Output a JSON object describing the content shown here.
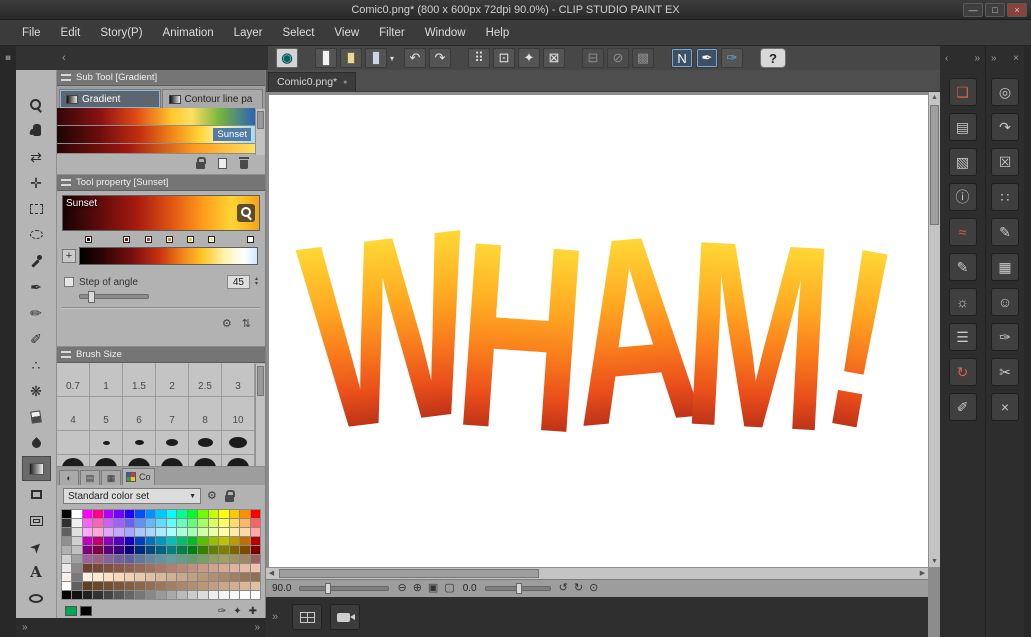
{
  "titlebar": {
    "title": "Comic0.png* (800 x 600px 72dpi 90.0%)  - CLIP STUDIO PAINT EX",
    "controls": [
      {
        "n": "minimize-button",
        "g": "—"
      },
      {
        "n": "restore-button",
        "g": "□"
      },
      {
        "n": "close-button",
        "g": "×"
      }
    ]
  },
  "menubar": {
    "items": [
      "File",
      "Edit",
      "Story(P)",
      "Animation",
      "Layer",
      "Select",
      "View",
      "Filter",
      "Window",
      "Help"
    ]
  },
  "command_bar": {
    "buttons": [
      {
        "n": "csp-logo-button",
        "g": "◉",
        "cls": "cbtn logo"
      },
      {
        "n": "new-file-button",
        "g": "",
        "cls": "cbtn i-page16 sp"
      },
      {
        "n": "open-file-button",
        "g": "",
        "cls": "cbtn i-folder16"
      },
      {
        "n": "save-button",
        "g": "",
        "cls": "cbtn i-floppy16 drop"
      },
      {
        "n": "undo-button",
        "g": "↶",
        "cls": "cbtn sp"
      },
      {
        "n": "redo-button",
        "g": "↷",
        "cls": "cbtn"
      },
      {
        "n": "delete-button",
        "g": "⠿",
        "cls": "cbtn sp"
      },
      {
        "n": "deselect-button",
        "g": "⊡",
        "cls": "cbtn"
      },
      {
        "n": "fill-button",
        "g": "✦",
        "cls": "cbtn"
      },
      {
        "n": "transform-button",
        "g": "⊠",
        "cls": "cbtn"
      },
      {
        "n": "align-left-button",
        "g": "⊟",
        "cls": "cbtn dis sp"
      },
      {
        "n": "align-center-button",
        "g": "⊘",
        "cls": "cbtn dis"
      },
      {
        "n": "align-grid-button",
        "g": "▩",
        "cls": "cbtn dis"
      },
      {
        "n": "no-correction-button",
        "g": "N",
        "cls": "cbtn on sp"
      },
      {
        "n": "stabilize-button",
        "g": "✒",
        "cls": "cbtn on"
      },
      {
        "n": "vector-snap-button",
        "g": "✑",
        "cls": "cbtn blue"
      },
      {
        "n": "help-button",
        "g": "?",
        "cls": "cbtn help sp"
      }
    ]
  },
  "left_dock": {
    "tools": [
      {
        "n": "zoom-tool",
        "g": "",
        "cls": "ticon i-zoom",
        "wcls": "tool-btn"
      },
      {
        "n": "hand-tool",
        "g": "",
        "cls": "ticon i-hand",
        "wcls": "tool-btn"
      },
      {
        "n": "flip-canvas-tool",
        "g": "⇄",
        "cls": "ticon",
        "wcls": "tool-btn"
      },
      {
        "n": "move-tool",
        "g": "✛",
        "cls": "ticon",
        "wcls": "tool-btn"
      },
      {
        "n": "marquee-select-tool",
        "g": "",
        "cls": "ticon i-rect",
        "wcls": "tool-btn"
      },
      {
        "n": "lasso-select-tool",
        "g": "",
        "cls": "ticon i-lasso",
        "wcls": "tool-btn"
      },
      {
        "n": "eyedropper-tool",
        "g": "",
        "cls": "ticon i-eyedrop",
        "wcls": "tool-btn"
      },
      {
        "n": "pen-tool",
        "g": "✒",
        "cls": "ticon",
        "wcls": "tool-btn"
      },
      {
        "n": "pencil-tool",
        "g": "✏",
        "cls": "ticon",
        "wcls": "tool-btn"
      },
      {
        "n": "brush-tool",
        "g": "✐",
        "cls": "ticon",
        "wcls": "tool-btn"
      },
      {
        "n": "airbrush-tool",
        "g": "∴",
        "cls": "ticon",
        "wcls": "tool-btn"
      },
      {
        "n": "decoration-tool",
        "g": "❋",
        "cls": "ticon",
        "wcls": "tool-btn"
      },
      {
        "n": "eraser-tool",
        "g": "",
        "cls": "ticon i-eraser",
        "wcls": "tool-btn"
      },
      {
        "n": "blend-tool",
        "g": "",
        "cls": "ticon i-drop",
        "wcls": "tool-btn"
      },
      {
        "n": "gradient-tool",
        "g": "",
        "cls": "ticon i-grad",
        "wcls": "tool-btn active"
      },
      {
        "n": "figure-tool",
        "g": "",
        "cls": "ticon i-square",
        "wcls": "tool-btn"
      },
      {
        "n": "frame-border-tool",
        "g": "",
        "cls": "ticon i-frame",
        "wcls": "tool-btn"
      },
      {
        "n": "operation-tool",
        "g": "➤",
        "cls": "ticon rotm45",
        "wcls": "tool-btn"
      },
      {
        "n": "text-tool",
        "g": "A",
        "cls": "ticon bold",
        "wcls": "tool-btn"
      },
      {
        "n": "balloon-tool",
        "g": "",
        "cls": "ticon i-balloon",
        "wcls": "tool-btn"
      }
    ]
  },
  "panels": {
    "sub_tool": {
      "header": "Sub Tool [Gradient]",
      "tabs": [
        {
          "label": "Gradient",
          "cls": "st-tab active",
          "n": "tab-gradient"
        },
        {
          "label": "Contour line pa",
          "cls": "st-tab",
          "n": "tab-contour-line"
        }
      ],
      "presets": [
        {
          "name": "",
          "style": "background:linear-gradient(90deg,#30060a 0%,#8c1212 22%,#e04a14 40%,#ffc62e 58%,#ffe061 68%,#77b43c 82%,#2b62b8 100%)",
          "lcls": "plabel",
          "n": "preset-row"
        },
        {
          "name": "Sunset",
          "style": "background:linear-gradient(90deg,#1c0404 0%,#6e0d0d 22%,#c42f10 42%,#f08519 58%,#ffd435 72%,#fff3a0 82%,#a8daf2 100%)",
          "lcls": "plabel sel",
          "n": "preset-row-sunset"
        },
        {
          "name": "",
          "style": "background:linear-gradient(90deg,#2a0505 0%,#a01410 35%,#ff9c1d 70%,#ffe061 100%)",
          "lcls": "plabel",
          "n": "preset-row"
        }
      ]
    },
    "tool_property": {
      "header": "Tool property [Sunset]",
      "preset_name": "Sunset",
      "preview_gradient": "linear-gradient(90deg,#170202 0%,#5c0b0b 18%,#a81b0e 38%,#e05313 55%,#ff9e1c 72%,#ffd435 86%,#f2a51a 100%)",
      "ramp_gradient": "linear-gradient(90deg,#000000 0%,#2a0404 12%,#7a0e0e 30%,#c8330f 45%,#f08519 58%,#ffc92b 70%,#fff3b0 82%,#ffffff 93%,#cfe9ff 100%)",
      "stops": [
        {
          "style": "left:2%;background:#3a0606"
        },
        {
          "style": "left:24%;background:#8a1010"
        },
        {
          "style": "left:36%;background:#d43a10"
        },
        {
          "style": "left:48%;background:#f07f1a"
        },
        {
          "style": "left:60%;background:#ffc31e"
        },
        {
          "style": "left:72%;background:#ffe95e"
        },
        {
          "style": "left:94%;background:#ffffff"
        }
      ],
      "angle": {
        "label": "Step of angle",
        "value": "45"
      },
      "plus_label": "+"
    },
    "brush_size": {
      "header": "Brush Size",
      "sizes": [
        "0.7",
        "1",
        "1.5",
        "2",
        "2.5",
        "3",
        "4",
        "5",
        "6",
        "7",
        "8",
        "10"
      ]
    },
    "color_set": {
      "tab_label": "Co",
      "dropdown_label": "Standard color set",
      "icon_tabs": [
        {
          "n": "color-wheel-tab",
          "g": "◐"
        },
        {
          "n": "color-slider-tab",
          "g": "▤"
        },
        {
          "n": "intermediate-color-tab",
          "g": "▦"
        }
      ],
      "footer_icons": [
        {
          "n": "eyedropper-icon",
          "g": "✑"
        },
        {
          "n": "key-icon",
          "g": "✦"
        },
        {
          "n": "add-swatch-icon",
          "g": "✚"
        }
      ],
      "recent": [
        "#00a651",
        "#000000"
      ],
      "colors": [
        "#000000",
        "#ffffff",
        "#ff00ff",
        "#ff0090",
        "#b000ff",
        "#7000ff",
        "#2000ff",
        "#0050ff",
        "#0090ff",
        "#00c8ff",
        "#00ffff",
        "#00ff90",
        "#00ff28",
        "#70ff00",
        "#c8ff00",
        "#ffff00",
        "#ffc800",
        "#ff9000",
        "#ff0000",
        "#303030",
        "#f0f0f0",
        "#ff60ff",
        "#ff60b8",
        "#cc60ff",
        "#a060ff",
        "#6a60ff",
        "#6090ff",
        "#60b8ff",
        "#60dcff",
        "#60ffff",
        "#60ffc0",
        "#60ff78",
        "#a8ff60",
        "#dcff60",
        "#ffff60",
        "#ffdc60",
        "#ffb860",
        "#ff6060",
        "#606060",
        "#e0e0e0",
        "#ffa8ff",
        "#ffa8d8",
        "#e0a8ff",
        "#c8a8ff",
        "#a8a8ff",
        "#a8c8ff",
        "#a8d8ff",
        "#a8ecff",
        "#a8ffff",
        "#a8ffdc",
        "#a8ffb8",
        "#d0ffa8",
        "#ecffa8",
        "#ffffa8",
        "#ffeca8",
        "#ffd8a8",
        "#ffa8a8",
        "#909090",
        "#d0d0d0",
        "#c000c0",
        "#c00070",
        "#8800c0",
        "#5500c0",
        "#1800c0",
        "#0040c0",
        "#0070c0",
        "#0098c0",
        "#00c0c0",
        "#00c070",
        "#00c020",
        "#58c000",
        "#98c000",
        "#c0c000",
        "#c09800",
        "#c07000",
        "#c00000",
        "#b0b0b0",
        "#c0c0c0",
        "#800080",
        "#80004a",
        "#5a0080",
        "#380080",
        "#100080",
        "#002a80",
        "#004a80",
        "#006480",
        "#008080",
        "#00804a",
        "#008015",
        "#3a8000",
        "#648000",
        "#808000",
        "#806400",
        "#804a00",
        "#800000",
        "#d0d0d0",
        "#a0a0a0",
        "#a060a0",
        "#a06080",
        "#8860a0",
        "#7060a0",
        "#6060a0",
        "#6078a0",
        "#6088a0",
        "#6094a0",
        "#60a0a0",
        "#60a088",
        "#60a068",
        "#78a060",
        "#94a060",
        "#a0a060",
        "#a09460",
        "#a08860",
        "#a06060",
        "#e8e8e8",
        "#888888",
        "#704030",
        "#784838",
        "#805040",
        "#885848",
        "#906050",
        "#986858",
        "#a07060",
        "#a87868",
        "#b08070",
        "#b88878",
        "#c09080",
        "#c89888",
        "#d0a090",
        "#d8a898",
        "#e0b0a0",
        "#e8b8a8",
        "#f0c0b0",
        "#f8f0e8",
        "#787878",
        "#fff0e0",
        "#ffe8d0",
        "#ffe0c0",
        "#f8d8b8",
        "#f0d0b0",
        "#e8c8a8",
        "#e0c0a0",
        "#d8b898",
        "#d0b090",
        "#c8a888",
        "#c0a080",
        "#b89878",
        "#b09070",
        "#a88868",
        "#a08060",
        "#987858",
        "#907050",
        "#ffffff",
        "#606060",
        "#604020",
        "#684828",
        "#705030",
        "#785838",
        "#806040",
        "#886848",
        "#907050",
        "#987858",
        "#a08060",
        "#a88868",
        "#b09070",
        "#b89878",
        "#c0a080",
        "#c8a888",
        "#d0b090",
        "#d8b898",
        "#e0c0a0",
        "#000000",
        "#111111",
        "#222222",
        "#333333",
        "#444444",
        "#555555",
        "#666666",
        "#777777",
        "#888888",
        "#999999",
        "#aaaaaa",
        "#bbbbbb",
        "#cccccc",
        "#dddddd",
        "#eeeeee",
        "#f4f4f4",
        "#f8f8f8",
        "#fcfcfc",
        "#ffffff"
      ]
    }
  },
  "canvas": {
    "tab": "Comic0.png*",
    "text": "WHAM!",
    "letters": [
      {
        "ch": "W"
      },
      {
        "ch": "H"
      },
      {
        "ch": "A"
      },
      {
        "ch": "M"
      },
      {
        "ch": "!"
      }
    ],
    "gradient": "linear-gradient(180deg,#ffee55 0%,#ffd233 18%,#ffab22 38%,#f97c1c 56%,#ea4e1b 72%,#b02a16 88%,#801a10 100%)"
  },
  "right_dock": {
    "col1": [
      {
        "n": "quick-access-icon",
        "g": "❏",
        "cls": "dicon red"
      },
      {
        "n": "navigator-icon",
        "g": "▤",
        "cls": "dicon"
      },
      {
        "n": "sub-view-icon",
        "g": "▧",
        "cls": "dicon"
      },
      {
        "n": "information-icon",
        "g": "ⓘ",
        "cls": "dicon"
      },
      {
        "n": "brush-stroke-icon",
        "g": "≈",
        "cls": "dicon red"
      },
      {
        "n": "search-pen-icon",
        "g": "✎",
        "cls": "dicon"
      },
      {
        "n": "light-table-icon",
        "g": "☼",
        "cls": "dicon"
      },
      {
        "n": "stroke-lines-icon",
        "g": "☰",
        "cls": "dicon"
      },
      {
        "n": "symmetry-rotate-icon",
        "g": "↻",
        "cls": "dicon red"
      },
      {
        "n": "pencil-slant-icon",
        "g": "✐",
        "cls": "dicon"
      }
    ],
    "col2": [
      {
        "n": "layer-circles-icon",
        "g": "◎",
        "cls": "dicon"
      },
      {
        "n": "export-layer-icon",
        "g": "↷",
        "cls": "dicon"
      },
      {
        "n": "close-grid-icon",
        "g": "☒",
        "cls": "dicon"
      },
      {
        "n": "halftone-dots-icon",
        "g": "∷",
        "cls": "dicon"
      },
      {
        "n": "add-pen-icon",
        "g": "✎",
        "cls": "dicon"
      },
      {
        "n": "add-image-icon",
        "g": "▦",
        "cls": "dicon"
      },
      {
        "n": "profile-icon",
        "g": "☺",
        "cls": "dicon"
      },
      {
        "n": "edit-pen-icon",
        "g": "✑",
        "cls": "dicon"
      },
      {
        "n": "scissors-icon",
        "g": "✂",
        "cls": "dicon"
      },
      {
        "n": "close-tool-icon",
        "g": "×",
        "cls": "dicon"
      }
    ]
  },
  "status_bar": {
    "zoom_value": "90.0",
    "rotate_value": "0.0",
    "zoom_icons": [
      {
        "n": "zoom-out-icon",
        "g": "⊖"
      },
      {
        "n": "zoom-in-icon",
        "g": "⊕"
      },
      {
        "n": "fit-to-screen-icon",
        "g": "▣"
      },
      {
        "n": "actual-size-icon",
        "g": "▢"
      }
    ],
    "rotate_icons": [
      {
        "n": "rotate-left-icon",
        "g": "↺"
      },
      {
        "n": "rotate-right-icon",
        "g": "↻"
      },
      {
        "n": "reset-rotation-icon",
        "g": "⊙"
      }
    ]
  },
  "dock_chevrons": {
    "left_outer": "«",
    "left_inner": "‹",
    "right_inner": "‹",
    "right_outer": "»",
    "close": "×",
    "bottom": "»"
  }
}
